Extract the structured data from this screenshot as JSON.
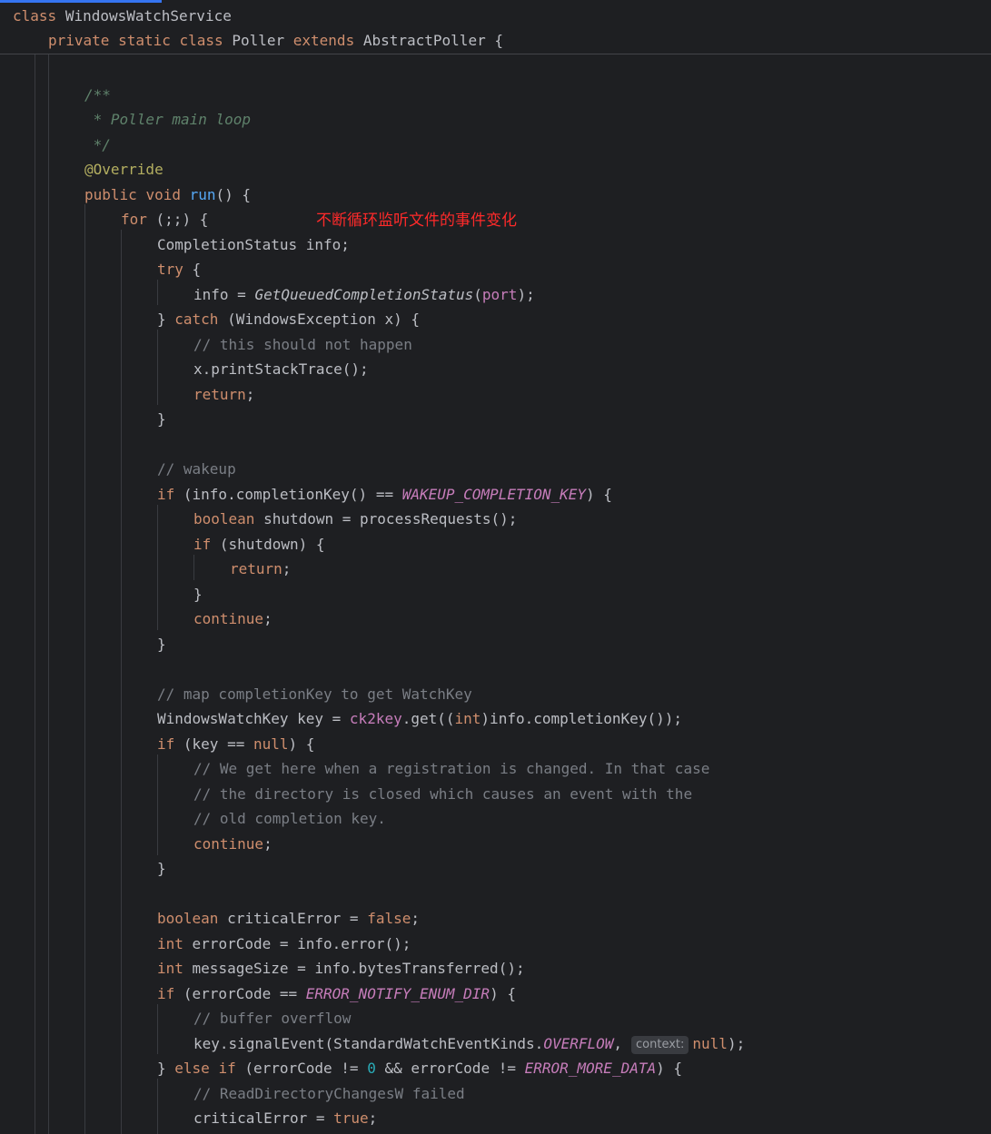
{
  "sticky_header": {
    "line1": {
      "kw": "class",
      "name": "WindowsWatchService"
    },
    "line2": {
      "kw1": "private",
      "kw2": "static",
      "kw3": "class",
      "name": "Poller",
      "kw4": "extends",
      "parent": "AbstractPoller",
      "brace": "{"
    }
  },
  "annotation_note": "不断循环监听文件的事件变化",
  "code": {
    "doc_open": "/**",
    "doc_body": " * Poller main loop",
    "doc_close": " */",
    "override": "@Override",
    "run_sig": {
      "kw1": "public",
      "kw2": "void",
      "name": "run",
      "rest": "() {"
    },
    "for_line": {
      "kw": "for",
      "rest": " (;;) {"
    },
    "decl_info": "CompletionStatus info;",
    "try_line": {
      "kw": "try",
      "rest": " {"
    },
    "info_assign": {
      "pre": "info = ",
      "fn": "GetQueuedCompletionStatus",
      "open": "(",
      "arg": "port",
      "close": ");"
    },
    "catch_line": {
      "pre": "} ",
      "kw": "catch",
      "rest": " (WindowsException x) {"
    },
    "comment_not_happen": "// this should not happen",
    "print_trace": "x.printStackTrace();",
    "return_1": "return",
    "semicolon": ";",
    "close_brace": "}",
    "comment_wakeup": "// wakeup",
    "if_wakeup": {
      "kw": "if",
      "pre": " (info.completionKey() == ",
      "const": "WAKEUP_COMPLETION_KEY",
      "post": ") {"
    },
    "shutdown_decl": {
      "kw": "boolean",
      "rest": " shutdown = processRequests();"
    },
    "if_shutdown": {
      "kw": "if",
      "rest": " (shutdown) {"
    },
    "continue_kw": "continue",
    "comment_map": "// map completionKey to get WatchKey",
    "key_decl": {
      "pre": "WindowsWatchKey key = ",
      "field": "ck2key",
      "mid": ".get((",
      "kw": "int",
      "post": ")info.completionKey());"
    },
    "if_key_null": {
      "kw": "if",
      "pre": " (key == ",
      "null": "null",
      "post": ") {"
    },
    "comment_reg_1": "// We get here when a registration is changed. In that case",
    "comment_reg_2": "// the directory is closed which causes an event with the",
    "comment_reg_3": "// old completion key.",
    "critical_decl": {
      "kw": "boolean",
      "mid": " criticalError = ",
      "val": "false",
      "end": ";"
    },
    "error_code_decl": {
      "kw": "int",
      "rest": " errorCode = info.error();"
    },
    "message_size_decl": {
      "kw": "int",
      "rest": " messageSize = info.bytesTransferred();"
    },
    "if_enum_dir": {
      "kw": "if",
      "pre": " (errorCode == ",
      "const": "ERROR_NOTIFY_ENUM_DIR",
      "post": ") {"
    },
    "comment_overflow": "// buffer overflow",
    "signal_event": {
      "pre": "key.signalEvent(StandardWatchEventKinds.",
      "const": "OVERFLOW",
      "comma": ",",
      "hint": "context:",
      "null": "null",
      "post": ");"
    },
    "else_if": {
      "pre": "} ",
      "kw1": "else",
      "kw2": "if",
      "mid": " (errorCode != ",
      "zero": "0",
      "mid2": " && errorCode != ",
      "const": "ERROR_MORE_DATA",
      "post": ") {"
    },
    "comment_failed": "// ReadDirectoryChangesW failed",
    "critical_true": {
      "pre": "criticalError = ",
      "val": "true",
      "end": ";"
    }
  }
}
